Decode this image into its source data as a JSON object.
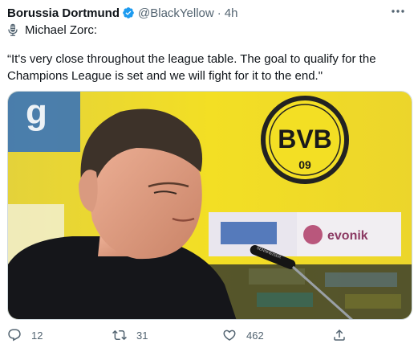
{
  "tweet": {
    "author_name": "Borussia Dortmund",
    "handle": "@BlackYellow",
    "separator": "·",
    "time": "4h",
    "speaker": "Michael Zorc:",
    "text": "“It's very close throughout the league table. The goal to qualify for the Champions League is set and we will fight for it to the end.\"",
    "media": {
      "crest_letters": "BVB",
      "crest_year": "09",
      "sponsor_text": "evonik",
      "mic_brand": "SENNHEISER"
    }
  },
  "actions": {
    "reply_count": "12",
    "retweet_count": "31",
    "like_count": "462"
  },
  "colors": {
    "text_primary": "#0f1419",
    "text_secondary": "#536471",
    "verified_blue": "#1d9bf0",
    "bvb_yellow": "#f2dc1f"
  },
  "icons": {
    "verified": "verified-badge-icon",
    "more": "more-dots-icon",
    "mic": "microphone-icon",
    "reply": "reply-icon",
    "retweet": "retweet-icon",
    "like": "heart-icon",
    "share": "share-icon"
  }
}
